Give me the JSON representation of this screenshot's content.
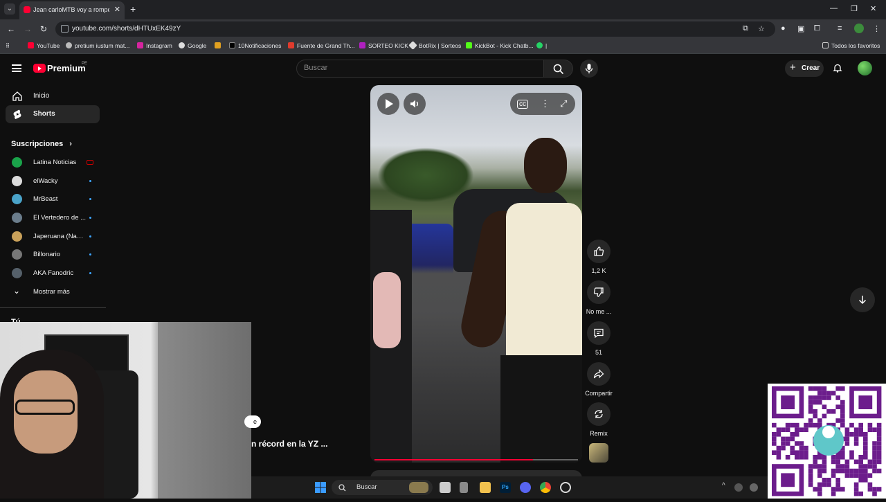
{
  "browser": {
    "tab_title": "Jean carloMTB voy a romper un",
    "url": "youtube.com/shorts/dHTUxEK49zY",
    "bookmarks": [
      "YouTube",
      "pretium iustum mat...",
      "Instagram",
      "Google",
      "10Notificaciones",
      "Fuente de Grand Th...",
      "SORTEO KICK",
      "BotRix | Sorteos",
      "KickBot - Kick Chatb..."
    ],
    "all_bookmarks": "Todos los favoritos"
  },
  "header": {
    "logo": "Premium",
    "logo_country": "PE",
    "search_placeholder": "Buscar",
    "create_label": "Crear"
  },
  "sidebar": {
    "items": [
      {
        "label": "Inicio",
        "icon": "home-icon"
      },
      {
        "label": "Shorts",
        "icon": "shorts-icon"
      }
    ],
    "subscriptions_heading": "Suscripciones",
    "subscriptions": [
      {
        "name": "Latina Noticias",
        "color": "#1aa34a",
        "status": "live"
      },
      {
        "name": "elWacky",
        "color": "#dcdcdc",
        "status": "new"
      },
      {
        "name": "MrBeast",
        "color": "#4aa3c9",
        "status": "new"
      },
      {
        "name": "El Vertedero de ...",
        "color": "#6b7d8c",
        "status": "new"
      },
      {
        "name": "Japeruana (Nam...",
        "color": "#c9a15a",
        "status": "new"
      },
      {
        "name": "Billonario",
        "color": "#777777",
        "status": "new"
      },
      {
        "name": "AKA Fanodric",
        "color": "#55606a",
        "status": "new"
      }
    ],
    "show_more": "Mostrar más",
    "you_heading": "Tú"
  },
  "short": {
    "progress_fraction": 0.78,
    "actions": {
      "like_count": "1,2 K",
      "dislike_label": "No me ...",
      "comment_count": "51",
      "share_label": "Compartir",
      "remix_label": "Remix"
    },
    "title_snippet": "n récord en la YZ ..."
  },
  "taskbar": {
    "search_label": "Buscar"
  },
  "colors": {
    "accent": "#ff0033",
    "background": "#0f0f0f"
  }
}
